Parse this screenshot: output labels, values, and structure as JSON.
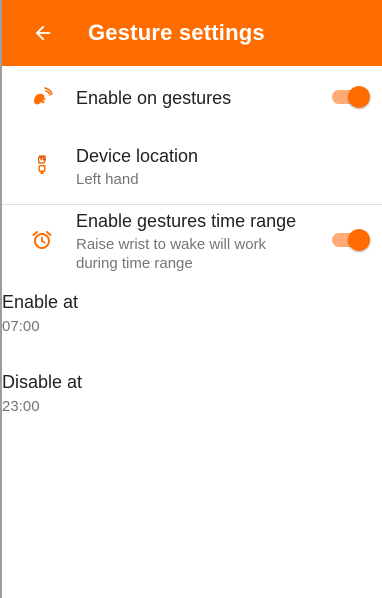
{
  "appbar": {
    "title": "Gesture settings",
    "back_icon": "arrow-left-icon",
    "color": "#ff6d00"
  },
  "settings": {
    "enable_on_gestures": {
      "label": "Enable on gestures",
      "enabled": true,
      "icon": "wave-hand-icon"
    },
    "device_location": {
      "label": "Device location",
      "value": "Left hand",
      "icon": "watch-icon"
    },
    "time_range": {
      "label": "Enable gestures time range",
      "description": "Raise wrist to wake will work during time range",
      "enabled": true,
      "icon": "alarm-clock-icon"
    },
    "enable_at": {
      "label": "Enable at",
      "value": "07:00"
    },
    "disable_at": {
      "label": "Disable at",
      "value": "23:00"
    }
  },
  "colors": {
    "accent": "#ff6d00",
    "accent_track": "#ffab76",
    "divider": "#e0e0e0"
  }
}
